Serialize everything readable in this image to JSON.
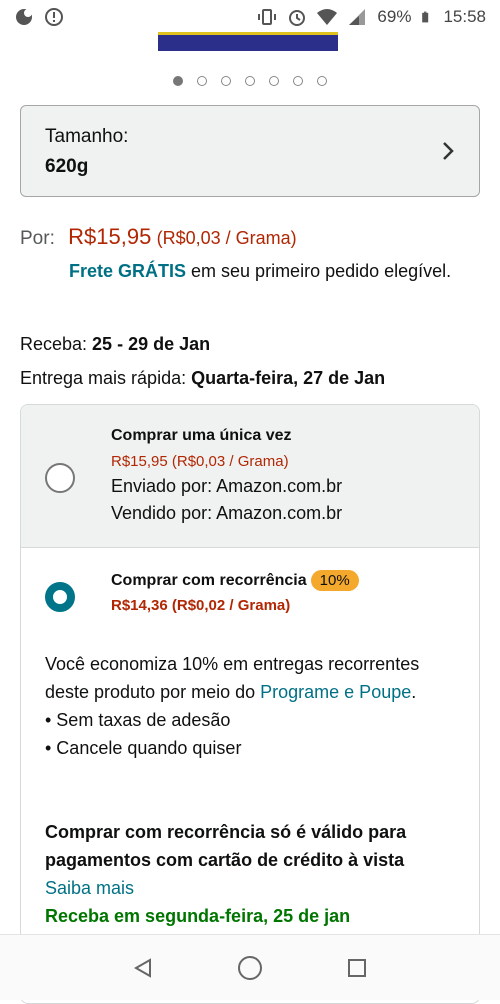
{
  "status_bar": {
    "battery_percent": "69%",
    "time": "15:58"
  },
  "carousel": {
    "count": 7,
    "active_index": 0
  },
  "size": {
    "label": "Tamanho:",
    "value": "620g"
  },
  "price": {
    "label": "Por:",
    "amount": "R$15,95",
    "unit": "(R$0,03 / Grama)"
  },
  "shipping": {
    "frete": "Frete GRÁTIS",
    "rest": " em seu primeiro pedido elegível."
  },
  "delivery": {
    "receba_label": "Receba:",
    "receba_value": " 25 - 29 de Jan",
    "fast_label": "Entrega mais rápida:",
    "fast_value": " Quarta-feira, 27 de Jan"
  },
  "option_once": {
    "title": "Comprar uma única vez",
    "price": "R$15,95 (R$0,03 / Grama)",
    "shipped_by": "Enviado por: Amazon.com.br",
    "sold_by": "Vendido por: Amazon.com.br"
  },
  "option_subscribe": {
    "title": "Comprar com recorrência",
    "badge": "10%",
    "price": "R$14,36 (R$0,02 / Grama)",
    "savings_text": "Você economiza 10% em entregas recorrentes deste produto por meio do ",
    "program_link": "Programe e Poupe",
    "period": ".",
    "bullet1": "• Sem taxas de adesão",
    "bullet2": "• Cancele quando quiser",
    "warning": "Comprar com recorrência só é válido para pagamentos com cartão de crédito à vista",
    "learn_more": "Saiba mais",
    "delivery": "Receba em segunda-feira, 25 de jan"
  },
  "colors": {
    "price": "#b12704",
    "link": "#007185",
    "badge": "#f4a82c",
    "green": "#007600",
    "radio": "#00758a"
  }
}
